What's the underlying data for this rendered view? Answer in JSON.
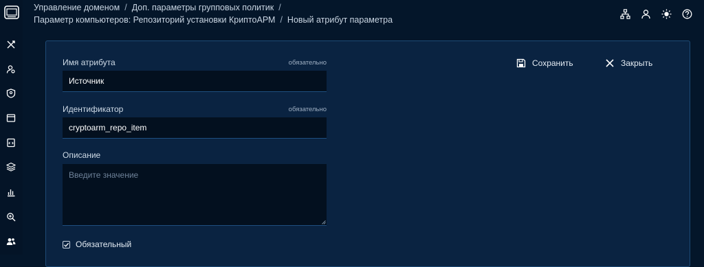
{
  "breadcrumbs": {
    "line1": [
      "Управление доменом",
      "Доп. параметры групповых политик"
    ],
    "line2": [
      "Параметр компьютеров: Репозиторий установки КриптоАРМ",
      "Новый атрибут параметра"
    ],
    "separator": "/"
  },
  "sidebar": {
    "items": [
      {
        "name": "tools-icon"
      },
      {
        "name": "user-search-icon"
      },
      {
        "name": "user-badge-icon"
      },
      {
        "name": "window-icon"
      },
      {
        "name": "code-file-icon"
      },
      {
        "name": "layers-icon"
      },
      {
        "name": "bar-chart-icon"
      },
      {
        "name": "zoom-search-icon"
      },
      {
        "name": "users-icon"
      }
    ]
  },
  "top_icons": [
    "sitemap-icon",
    "user-icon",
    "sun-icon",
    "help-icon"
  ],
  "form": {
    "attr_name": {
      "label": "Имя атрибута",
      "required_tag": "обязательно",
      "value": "Источник"
    },
    "identifier": {
      "label": "Идентификатор",
      "required_tag": "обязательно",
      "value": "cryptoarm_repo_item"
    },
    "description": {
      "label": "Описание",
      "placeholder": "Введите значение",
      "value": ""
    },
    "required_checkbox": {
      "label": "Обязательный",
      "checked": true
    }
  },
  "actions": {
    "save_label": "Сохранить",
    "close_label": "Закрыть"
  },
  "colors": {
    "background": "#04162a",
    "panel": "#0a2341",
    "panel_border": "#1d4a76",
    "input_bg": "#03101f"
  }
}
